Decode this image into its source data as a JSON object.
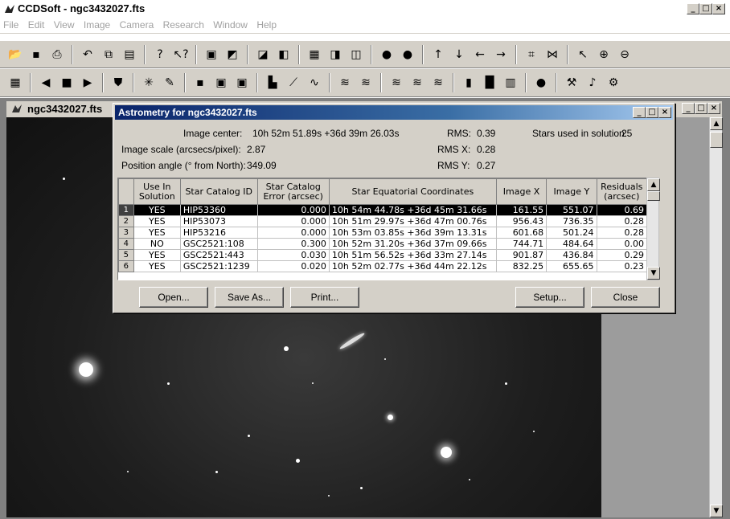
{
  "app": {
    "title": "CCDSoft  - ngc3432027.fts",
    "window_buttons": [
      "_",
      "□",
      "×"
    ]
  },
  "menu": [
    "File",
    "Edit",
    "View",
    "Image",
    "Camera",
    "Research",
    "Window",
    "Help"
  ],
  "toolbar1": [
    {
      "icon": "open-icon",
      "glyph": "📂"
    },
    {
      "icon": "save-icon",
      "glyph": "▪"
    },
    {
      "icon": "print-icon",
      "glyph": "⎙"
    },
    {
      "icon": "undo-icon",
      "glyph": "↶"
    },
    {
      "icon": "copy-icon",
      "glyph": "⧉"
    },
    {
      "icon": "paste-icon",
      "glyph": "▤"
    },
    {
      "icon": "help-icon",
      "glyph": "?"
    },
    {
      "icon": "context-help-icon",
      "glyph": "↖?"
    },
    {
      "icon": "image-icon-1",
      "glyph": "▣"
    },
    {
      "icon": "image-icon-2",
      "glyph": "◩"
    },
    {
      "icon": "image-icon-3",
      "glyph": "◪"
    },
    {
      "icon": "image-icon-4",
      "glyph": "◧"
    },
    {
      "icon": "image-icon-5",
      "glyph": "▦"
    },
    {
      "icon": "image-icon-6",
      "glyph": "◨"
    },
    {
      "icon": "image-icon-7",
      "glyph": "◫"
    },
    {
      "icon": "pill-icon-1",
      "glyph": "●"
    },
    {
      "icon": "pill-icon-2",
      "glyph": "●"
    },
    {
      "icon": "arrow-up-icon",
      "glyph": "↑"
    },
    {
      "icon": "arrow-down-icon",
      "glyph": "↓"
    },
    {
      "icon": "arrow-left-icon",
      "glyph": "←"
    },
    {
      "icon": "arrow-right-icon",
      "glyph": "→"
    },
    {
      "icon": "expand-icon",
      "glyph": "⌗"
    },
    {
      "icon": "shrink-icon",
      "glyph": "⋈"
    },
    {
      "icon": "pointer-icon",
      "glyph": "↖"
    },
    {
      "icon": "zoom-in-icon",
      "glyph": "⊕"
    },
    {
      "icon": "zoom-out-icon",
      "glyph": "⊖"
    }
  ],
  "toolbar2": [
    {
      "icon": "grid-icon",
      "glyph": "▦"
    },
    {
      "icon": "prev-icon",
      "glyph": "◀"
    },
    {
      "icon": "stop-icon",
      "glyph": "■"
    },
    {
      "icon": "next-icon",
      "glyph": "▶"
    },
    {
      "icon": "filter-icon",
      "glyph": "⛊"
    },
    {
      "icon": "sun-icon",
      "glyph": "✳"
    },
    {
      "icon": "brush-icon",
      "glyph": "✎"
    },
    {
      "icon": "dot-icon",
      "glyph": "▪"
    },
    {
      "icon": "black-square-icon",
      "glyph": "▣"
    },
    {
      "icon": "black-square-2-icon",
      "glyph": "▣"
    },
    {
      "icon": "histogram-icon",
      "glyph": "▙"
    },
    {
      "icon": "graph-icon",
      "glyph": "⟋"
    },
    {
      "icon": "curve-icon",
      "glyph": "∿"
    },
    {
      "icon": "stack-icon-1",
      "glyph": "≋"
    },
    {
      "icon": "stack-icon-2",
      "glyph": "≋"
    },
    {
      "icon": "stack-icon-3",
      "glyph": "≋"
    },
    {
      "icon": "stack-icon-4",
      "glyph": "≋"
    },
    {
      "icon": "stack-icon-5",
      "glyph": "≋"
    },
    {
      "icon": "gray-bar-icon",
      "glyph": "▮"
    },
    {
      "icon": "gray-block-icon",
      "glyph": "█"
    },
    {
      "icon": "spectrum-icon",
      "glyph": "▥"
    },
    {
      "icon": "circle-icon",
      "glyph": "●"
    },
    {
      "icon": "tools-icon",
      "glyph": "⚒"
    },
    {
      "icon": "sound-icon",
      "glyph": "♪"
    },
    {
      "icon": "settings-icon",
      "glyph": "⚙"
    }
  ],
  "child_window": {
    "title": "ngc3432027.fts"
  },
  "dialog": {
    "title": "Astrometry for ngc3432027.fts",
    "image_center_label": "Image center:",
    "image_center_value": "10h 52m 51.89s  +36d 39m 26.03s",
    "rms_label": "RMS:",
    "rms_value": "0.39",
    "stars_used_label": "Stars used in solution:",
    "stars_used_value": "25",
    "image_scale_label": "Image scale (arcsecs/pixel):",
    "image_scale_value": "2.87",
    "rmsx_label": "RMS X:",
    "rmsx_value": "0.28",
    "position_angle_label": "Position angle (° from North):",
    "position_angle_value": "349.09",
    "rmsy_label": "RMS Y:",
    "rmsy_value": "0.27",
    "table": {
      "headers": [
        "",
        "Use In Solution",
        "Star Catalog ID",
        "Star Catalog Error (arcsec)",
        "Star Equatorial Coordinates",
        "Image X",
        "Image Y",
        "Residuals (arcsec)"
      ],
      "rows": [
        {
          "n": "1",
          "use": "YES",
          "id": "HIP53360",
          "err": "0.000",
          "coords": "10h 54m 44.78s  +36d 45m 31.66s",
          "x": "161.55",
          "y": "551.07",
          "res": "0.69"
        },
        {
          "n": "2",
          "use": "YES",
          "id": "HIP53073",
          "err": "0.000",
          "coords": "10h 51m 29.97s  +36d 47m 00.76s",
          "x": "956.43",
          "y": "736.35",
          "res": "0.28"
        },
        {
          "n": "3",
          "use": "YES",
          "id": "HIP53216",
          "err": "0.000",
          "coords": "10h 53m 03.85s  +36d 39m 13.31s",
          "x": "601.68",
          "y": "501.24",
          "res": "0.28"
        },
        {
          "n": "4",
          "use": "NO",
          "id": "GSC2521:108",
          "err": "0.300",
          "coords": "10h 52m 31.20s  +36d 37m 09.66s",
          "x": "744.71",
          "y": "484.64",
          "res": "0.00"
        },
        {
          "n": "5",
          "use": "YES",
          "id": "GSC2521:443",
          "err": "0.030",
          "coords": "10h 51m 56.52s  +36d 33m 27.14s",
          "x": "901.87",
          "y": "436.84",
          "res": "0.29"
        },
        {
          "n": "6",
          "use": "YES",
          "id": "GSC2521:1239",
          "err": "0.020",
          "coords": "10h 52m 02.77s  +36d 44m 22.12s",
          "x": "832.25",
          "y": "655.65",
          "res": "0.23"
        }
      ],
      "selected_row": 0
    },
    "buttons": {
      "open": "Open...",
      "save_as": "Save As...",
      "print": "Print...",
      "setup": "Setup...",
      "close": "Close"
    }
  },
  "colors": {
    "dialog_title_start": "#0a246a",
    "dialog_title_end": "#a6caf0",
    "face": "#d4d0c8"
  }
}
